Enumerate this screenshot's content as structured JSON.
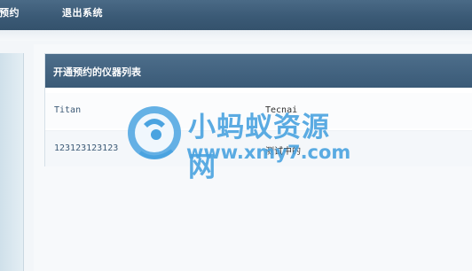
{
  "nav": {
    "items": [
      {
        "label": "预约"
      },
      {
        "label": "退出系统"
      }
    ]
  },
  "panel": {
    "title": "开通预约的仪器列表"
  },
  "instruments": [
    {
      "name": "Titan",
      "model": "Tecnai"
    },
    {
      "name": "123123123123",
      "model": "测试中的"
    }
  ],
  "watermark": {
    "site_name": "小蚂蚁资源网",
    "url": "www.xmy7.com"
  },
  "colors": {
    "nav_bg": "#3b5a76",
    "panel_header_bg": "#3a5a77",
    "link_text": "#3c5a76",
    "watermark": "#4aa3e0"
  }
}
